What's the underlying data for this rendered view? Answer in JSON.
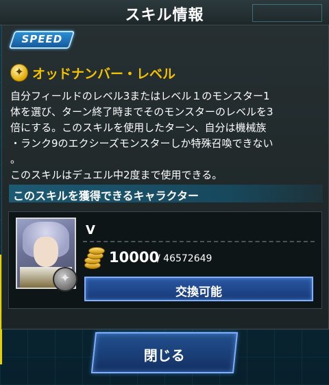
{
  "header": {
    "title": "スキル情報"
  },
  "skill": {
    "badge": "SPEED",
    "icon": "skill-star-icon",
    "name": "オッドナンバー・レベル",
    "description": [
      "自分フィールドのレベル3またはレベル１のモンスター1",
      "体を選び、ターン終了時までそのモンスターのレベルを3",
      "倍にする。このスキルを使用したターン、自分は機械族",
      "・ランク9のエクシーズモンスターしか特殊召喚できない",
      "。",
      "このスキルはデュエル中2度まで使用できる。"
    ]
  },
  "characters": {
    "header": "このスキルを獲得できるキャラクター",
    "items": [
      {
        "name": "V",
        "price": "10000",
        "owned": "/ 46572649",
        "button": "交換可能"
      }
    ]
  },
  "footer": {
    "close_label": "閉じる"
  },
  "colors": {
    "skill_name": "#f2c200",
    "header_bg": "#2c3a3d",
    "button_blue": "#173a78",
    "section_header": "#1c5a73"
  }
}
